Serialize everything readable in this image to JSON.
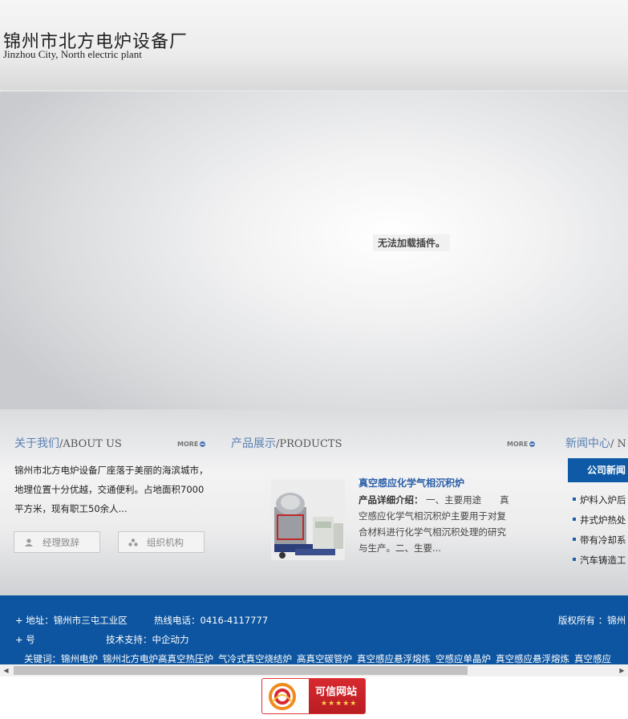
{
  "header": {
    "logo_cn": "锦州市北方电炉设备厂",
    "logo_en": "Jinzhou City, North electric plant"
  },
  "banner": {
    "plugin_message": "无法加载插件。"
  },
  "about": {
    "title_cn": "关于我们",
    "title_en": "/ABOUT US",
    "more": "MORE",
    "text": "锦州市北方电炉设备厂座落于美丽的海滨城市，地理位置十分优越，交通便利。占地面积7000平方米，现有职工50余人...",
    "buttons": [
      "经理致辞",
      "组织机构"
    ]
  },
  "products": {
    "title_cn": "产品展示",
    "title_en": "/PRODUCTS",
    "more": "MORE",
    "name": "真空感应化学气相沉积炉",
    "desc_label": "产品详细介绍：",
    "desc": "一、主要用途　　真空感应化学气相沉积炉主要用于对复合材料进行化学气相沉积处理的研究与生产。二、生要..."
  },
  "news": {
    "title_cn": "新闻中心",
    "title_en": "/ N",
    "tab": "公司新闻",
    "items": [
      "炉料入炉后",
      "井式炉热处",
      "带有冷却系",
      "汽车铸造工"
    ]
  },
  "footer": {
    "address": "+ 地址：锦州市三屯工业区",
    "hotline": "热线电话：0416-4117777",
    "copyright": "版权所有 ：锦州",
    "icp": "+ 号",
    "support": "技术支持：中企动力",
    "keywords_label": "关键词：",
    "keywords": [
      "锦州电炉",
      "锦州北方电炉高真空热压炉",
      "气冷式真空烧结炉",
      "高真空碳管炉",
      "真空感应悬浮熔炼",
      "空感应单晶炉",
      "真空感应悬浮熔炼",
      "真空感应"
    ]
  },
  "badge": {
    "text": "可信网站",
    "stars": "★★★★★"
  },
  "colors": {
    "accent": "#0d55a0",
    "title_blue": "#5a7fb3",
    "product_link": "#2a5fa8"
  }
}
